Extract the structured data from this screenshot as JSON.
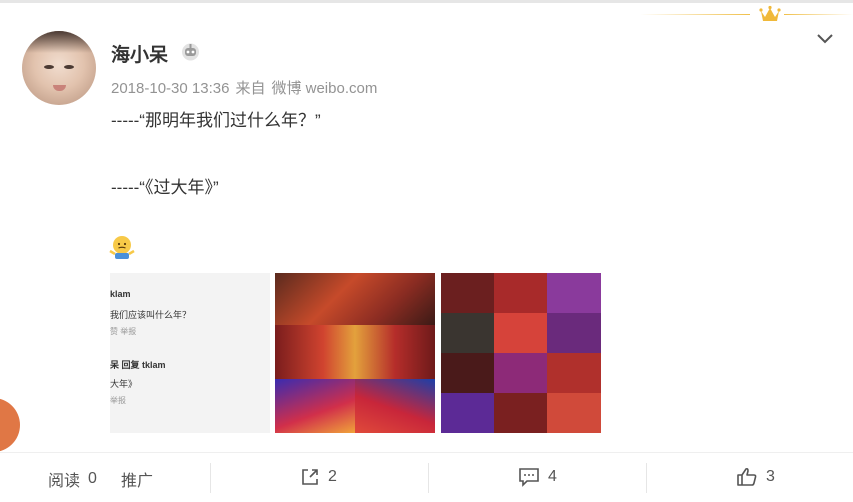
{
  "post": {
    "username": "海小呆",
    "meta_date": "2018-10-30 13:36",
    "meta_from": "来自",
    "meta_source": "微博 weibo.com",
    "lines": [
      "-----“那明年我们过什么年？”",
      "-----“《过大年》”"
    ]
  },
  "screenshot_image": {
    "line1": "klam",
    "line2": "我们应该叫什么年？",
    "line3": "赞   举报",
    "line4": "呆 回复 tklam",
    "line5": "大年》",
    "line6": "举报"
  },
  "actions": {
    "read_label": "阅读",
    "read_count": "0",
    "promote_label": "推广",
    "share_count": "2",
    "comment_count": "4",
    "like_count": "3"
  },
  "icons": [
    "crown-icon",
    "chevron-down-icon",
    "robot-badge-icon",
    "shrug-emoji-icon",
    "share-icon",
    "comment-icon",
    "like-icon"
  ],
  "colors": {
    "accent_gold": "#f0c04a",
    "meta_gray": "#939393",
    "orange": "#e07745"
  }
}
